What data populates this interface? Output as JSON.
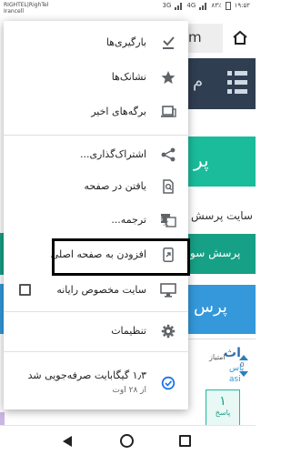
{
  "status_bar": {
    "carrier_1": "RIGHTEL|RighTel",
    "carrier_2": "Irancell",
    "network": "3G",
    "network_2": "4G",
    "battery": "۸۳٪",
    "time": "۱۹:۵۲"
  },
  "background_page": {
    "url_fragment": "m",
    "green_banner": "پر",
    "question_text": "سایت پرسش",
    "teal_banner": "پرسش سو",
    "blue_banner": "پرس",
    "score_label": "امتیاز",
    "vote_count": "0",
    "question_title": "اث",
    "question_link": "پاس",
    "question_link_2": "asi",
    "answer_count": "۱",
    "answer_label": "پاسخ"
  },
  "menu": {
    "items": [
      {
        "label": "بارگیری‌ها",
        "icon": "download-done-icon"
      },
      {
        "label": "نشانک‌ها",
        "icon": "star-icon"
      },
      {
        "label": "برگه‌های اخیر",
        "icon": "recent-tabs-icon"
      },
      {
        "label": "اشتراک‌گذاری...",
        "icon": "share-icon"
      },
      {
        "label": "یافتن در صفحه",
        "icon": "find-in-page-icon"
      },
      {
        "label": "ترجمه...",
        "icon": "translate-icon"
      },
      {
        "label": "افزودن به صفحه اصلی",
        "icon": "add-to-home-icon"
      },
      {
        "label": "سایت مخصوص رایانه",
        "icon": "desktop-icon",
        "checked": false
      },
      {
        "label": "تنظیمات",
        "icon": "gear-icon"
      },
      {
        "label": "۱٫۳ گیگابایت صرفه‌جویی شد",
        "sublabel": "از ۲۸ اوت",
        "icon": "data-saver-icon"
      }
    ]
  },
  "colors": {
    "icon_gray": "#5f6368",
    "highlight_border": "#000000",
    "nav_dark": "#2f3e51",
    "green": "#1abc9c",
    "teal": "#16a085",
    "blue": "#3498db",
    "saver_blue": "#1a73e8"
  }
}
